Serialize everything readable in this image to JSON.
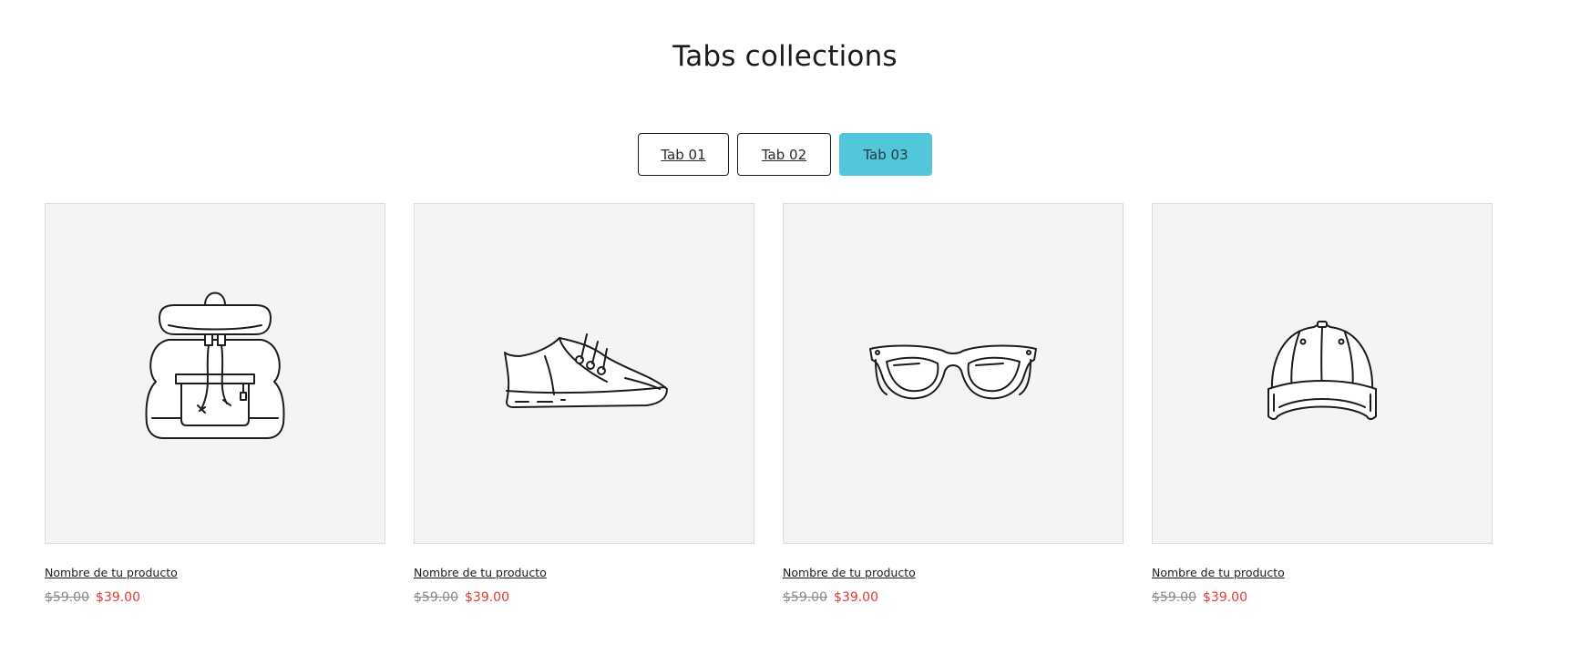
{
  "section": {
    "title": "Tabs collections"
  },
  "tabs": [
    {
      "label": "Tab 01",
      "active": false
    },
    {
      "label": "Tab 02",
      "active": false
    },
    {
      "label": "Tab 03",
      "active": true
    }
  ],
  "colors": {
    "accent": "#52c7d9",
    "sale_price": "#e53935",
    "card_bg": "#f4f4f4"
  },
  "products": [
    {
      "name": "Nombre de tu producto",
      "compare_price": "$59.00",
      "price": "$39.00",
      "icon": "backpack-icon"
    },
    {
      "name": "Nombre de tu producto",
      "compare_price": "$59.00",
      "price": "$39.00",
      "icon": "sneaker-icon"
    },
    {
      "name": "Nombre de tu producto",
      "compare_price": "$59.00",
      "price": "$39.00",
      "icon": "sunglasses-icon"
    },
    {
      "name": "Nombre de tu producto",
      "compare_price": "$59.00",
      "price": "$39.00",
      "icon": "cap-icon"
    }
  ]
}
